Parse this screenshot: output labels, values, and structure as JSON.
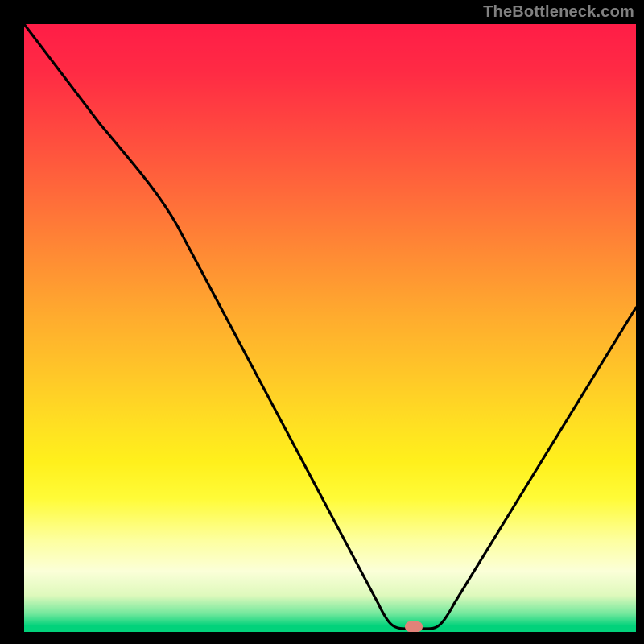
{
  "watermark": "TheBottleneck.com",
  "marker": {
    "x_pct": 63.5,
    "y_pct": 99.0
  },
  "chart_data": {
    "type": "line",
    "title": "",
    "xlabel": "",
    "ylabel": "",
    "xlim": [
      0,
      100
    ],
    "ylim": [
      0,
      100
    ],
    "series": [
      {
        "name": "bottleneck-curve",
        "x": [
          0,
          10,
          20,
          28,
          36,
          44,
          52,
          58,
          62,
          66,
          72,
          80,
          90,
          100
        ],
        "y": [
          100,
          85,
          72,
          62,
          48,
          34,
          20,
          8,
          2,
          2,
          8,
          20,
          36,
          50
        ]
      }
    ],
    "annotations": [
      {
        "name": "optimal-point",
        "x": 64,
        "y": 1
      }
    ],
    "background": "red-yellow-green vertical gradient (high=top=red, low=bottom=green)"
  }
}
